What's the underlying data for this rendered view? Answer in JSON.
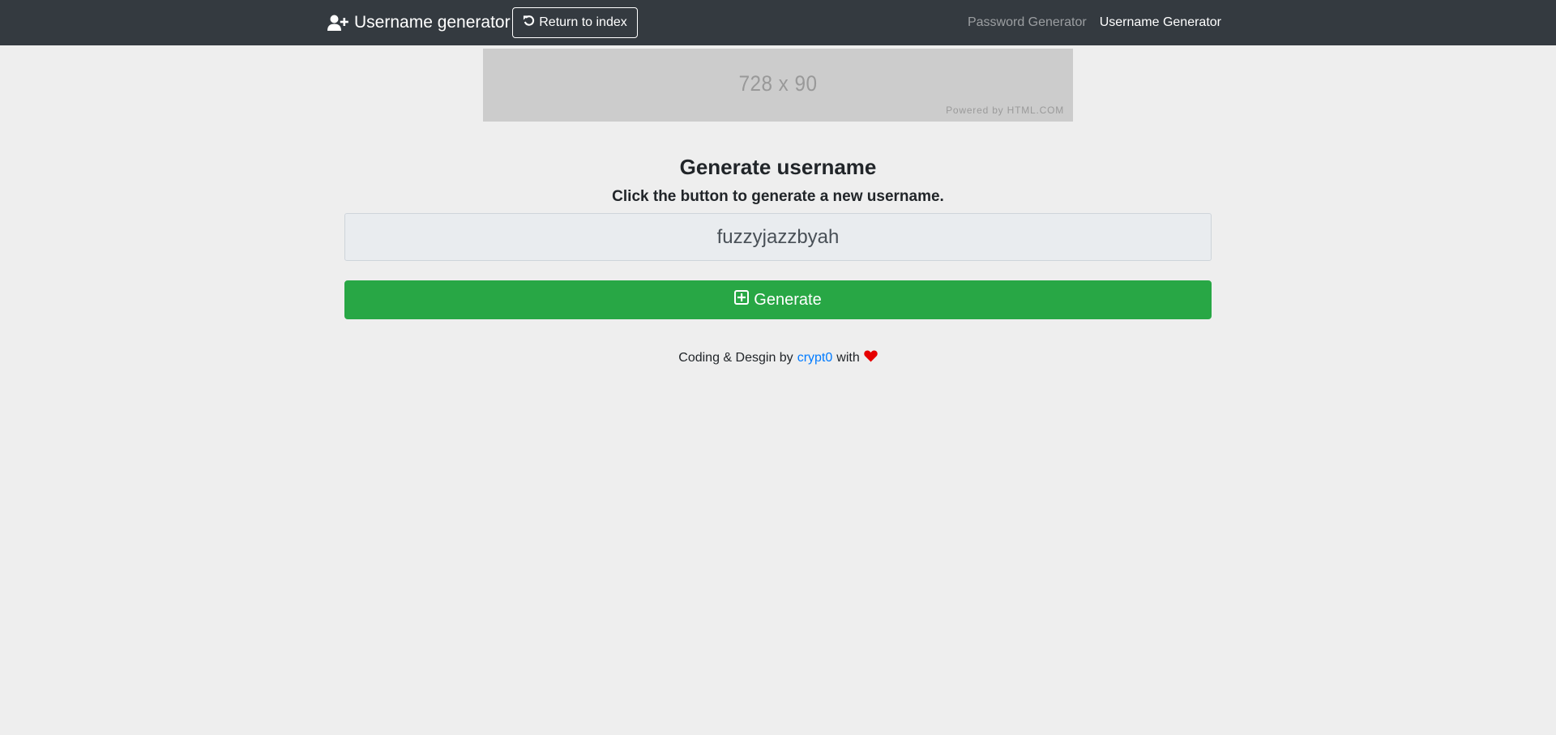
{
  "navbar": {
    "brand": {
      "icon": "user-plus-icon",
      "label": "Username generator"
    },
    "return_button": {
      "icon": "undo-icon",
      "label": "Return to index"
    },
    "links": [
      {
        "label": "Password Generator",
        "active": false
      },
      {
        "label": "Username Generator",
        "active": true
      }
    ]
  },
  "ad": {
    "size_label": "728 x 90",
    "credit": "Powered by HTML.COM"
  },
  "main": {
    "title": "Generate username",
    "subtitle": "Click the button to generate a new username.",
    "username_value": "fuzzyjazzbyah",
    "generate_button": {
      "icon": "plus-square-icon",
      "label": "Generate"
    }
  },
  "footer": {
    "prefix": "Coding & Desgin by",
    "author": "crypt0",
    "suffix": "with",
    "icon": "heart-icon"
  },
  "colors": {
    "navbar_bg": "#343a40",
    "page_bg": "#eeeeee",
    "generate_green": "#28a745",
    "link_blue": "#007bff",
    "heart_red": "#e60000"
  }
}
